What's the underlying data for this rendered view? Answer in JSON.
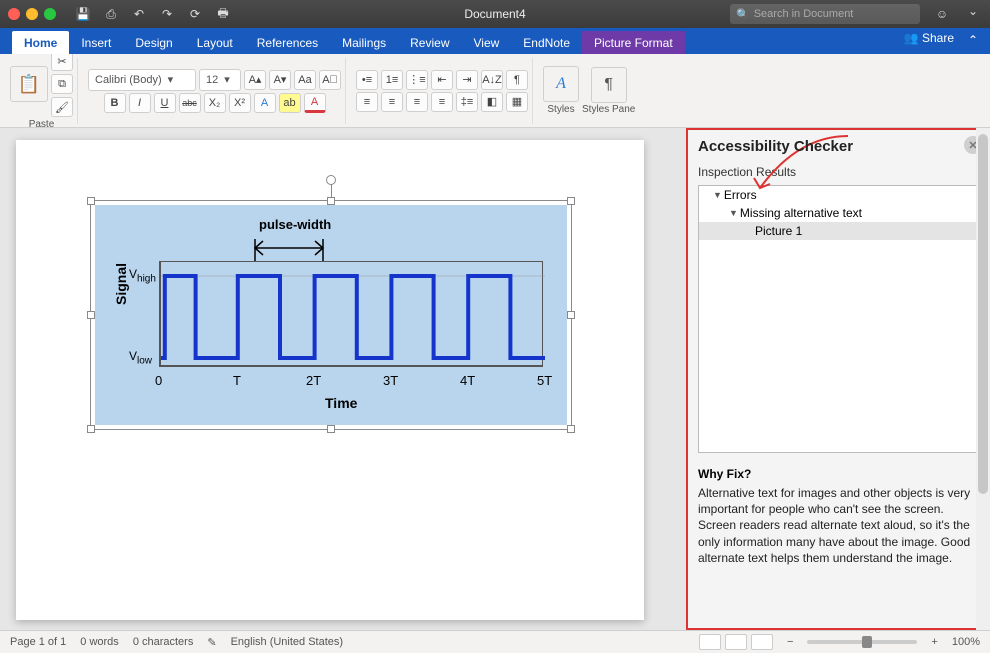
{
  "titlebar": {
    "doc_name": "Document4",
    "search_placeholder": "Search in Document"
  },
  "tabs": {
    "home": "Home",
    "insert": "Insert",
    "design": "Design",
    "layout": "Layout",
    "references": "References",
    "mailings": "Mailings",
    "review": "Review",
    "view": "View",
    "endnote": "EndNote",
    "picture_format": "Picture Format",
    "share": "Share"
  },
  "ribbon": {
    "paste": "Paste",
    "font_name": "Calibri (Body)",
    "font_size": "12",
    "bold": "B",
    "italic": "I",
    "underline": "U",
    "strike": "abc",
    "styles": "Styles",
    "styles_pane": "Styles Pane"
  },
  "sidepane": {
    "title": "Accessibility Checker",
    "subheader": "Inspection Results",
    "errors_label": "Errors",
    "error_category": "Missing alternative text",
    "error_item": "Picture 1",
    "why_header": "Why Fix?",
    "why_body": "Alternative text for images and other objects is very important for people who can't see the screen. Screen readers read alternate text aloud, so it's the only information many have about the image. Good alternate text helps them understand the image."
  },
  "status": {
    "page": "Page 1 of 1",
    "words": "0 words",
    "chars": "0 characters",
    "lang": "English (United States)",
    "zoom": "100%"
  },
  "chart_data": {
    "type": "line",
    "title": "",
    "annotation": "pulse-width",
    "xlabel": "Time",
    "ylabel": "Signal",
    "x_ticks": [
      "0",
      "T",
      "2T",
      "3T",
      "4T",
      "5T"
    ],
    "y_ticks": [
      "V_low",
      "V_high"
    ],
    "y_tick_raw": {
      "low": "Vlow",
      "high": "Vhigh"
    },
    "xlim": [
      0,
      5
    ],
    "ylim": [
      0,
      1
    ],
    "description": "Square-wave pulse signal alternating between V_low and V_high with constant period T; pulse-width annotation spans approximately T to 2T.",
    "series": [
      {
        "name": "signal",
        "x": [
          0.0,
          0.05,
          0.05,
          0.45,
          0.45,
          1.0,
          1.0,
          1.55,
          1.55,
          2.0,
          2.0,
          2.55,
          2.55,
          3.0,
          3.0,
          3.55,
          3.55,
          4.0,
          4.0,
          4.55,
          4.55,
          5.0
        ],
        "y": [
          0,
          0,
          1,
          1,
          0,
          0,
          1,
          1,
          0,
          0,
          1,
          1,
          0,
          0,
          1,
          1,
          0,
          0,
          1,
          1,
          0,
          0
        ]
      }
    ]
  }
}
